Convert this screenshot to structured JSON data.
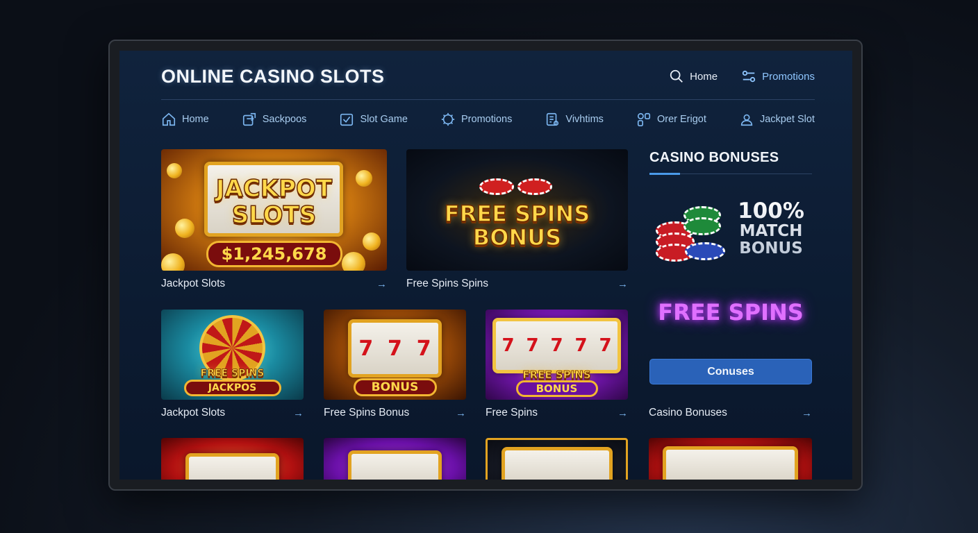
{
  "header": {
    "title": "ONLINE CASINO SLOTS",
    "top_nav": [
      {
        "label": "Home",
        "icon": "search-icon"
      },
      {
        "label": "Promotions",
        "icon": "toggle-icon"
      }
    ]
  },
  "nav": [
    {
      "label": "Home",
      "icon": "home-icon"
    },
    {
      "label": "Sackpoos",
      "icon": "transfer-icon"
    },
    {
      "label": "Slot Game",
      "icon": "checkbox-icon"
    },
    {
      "label": "Promotions",
      "icon": "gear-icon"
    },
    {
      "label": "Vivhtims",
      "icon": "document-icon"
    },
    {
      "label": "Orer Erigot",
      "icon": "grid-icon"
    },
    {
      "label": "Jackpet Slot",
      "icon": "user-icon"
    }
  ],
  "cards": {
    "jackpot_big": {
      "art_line1": "JACKPOT",
      "art_line2": "SLOTS",
      "amount": "$1,245,678",
      "caption": "Jackpot Slots",
      "arrow": "→"
    },
    "free_spins_big": {
      "art_line1": "FREE SPINS",
      "art_line2": "BONUS",
      "caption": "Free Spins Spins",
      "arrow": "→"
    },
    "jackpot_small": {
      "art_line1": "FREE SPINS",
      "art_line2": "JACKPOS",
      "caption": "Jackpot Slots",
      "arrow": "→"
    },
    "free_spins_bonus": {
      "reel_symbols": [
        "7",
        "7",
        "7"
      ],
      "pill": "BONUS",
      "caption": "Free Spins Bonus",
      "arrow": "→"
    },
    "free_spins": {
      "reel_symbols": [
        "7",
        "7",
        "7",
        "7",
        "7"
      ],
      "art_line1": "FREE SPINS",
      "art_line2": "BONUS",
      "caption": "Free Spins",
      "arrow": "→"
    },
    "casino_bonuses": {
      "caption": "Casino Bonuses",
      "arrow": "→"
    }
  },
  "sidebar": {
    "title": "CASINO BONUSES",
    "match_line1": "100%",
    "match_line2": "MATCH",
    "match_line3": "BONUS",
    "free_spins": "FREE SPINS",
    "button": "Conuses"
  },
  "colors": {
    "background": "#0c1b31",
    "accent_blue": "#2a62b8",
    "nav_text": "#a9cdf0",
    "gold": "#ffd84a",
    "purple_glow": "#e070ff"
  }
}
